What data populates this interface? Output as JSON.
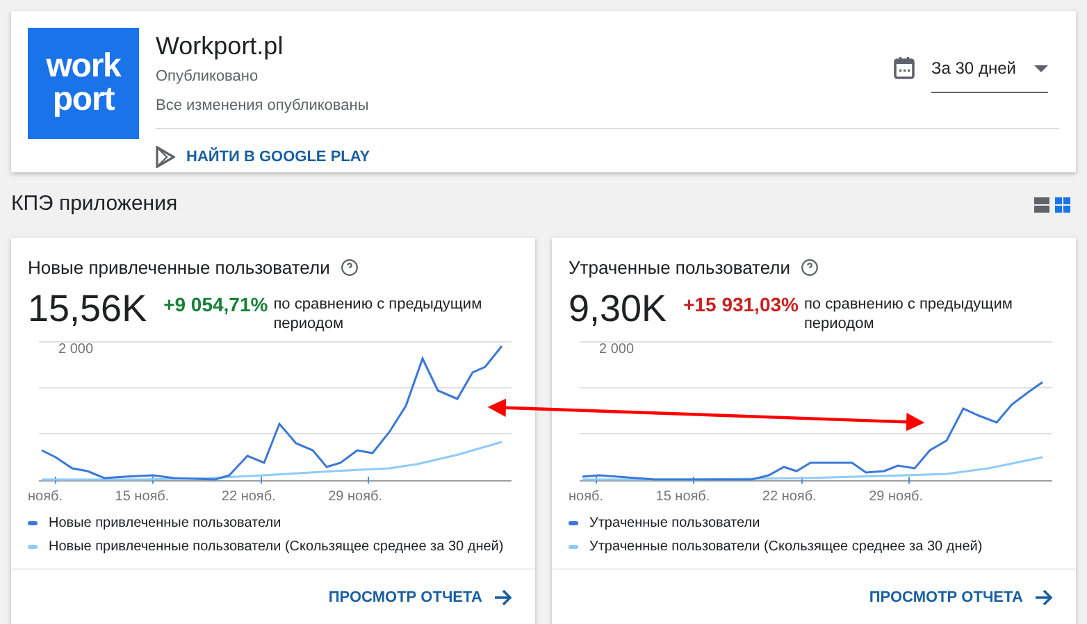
{
  "app": {
    "logo_lines": [
      "work",
      "port"
    ],
    "name": "Workport.pl",
    "status": "Опубликовано",
    "changes": "Все изменения опубликованы",
    "store_link": "НАЙТИ В GOOGLE PLAY"
  },
  "period": {
    "value": "За 30 дней"
  },
  "section_title": "КПЭ приложения",
  "view_toggle": [
    {
      "kind": "list",
      "selected": false
    },
    {
      "kind": "grid",
      "selected": true
    }
  ],
  "cards": [
    {
      "title": "Новые привлеченные пользователи",
      "value": "15,56K",
      "change": "+9 054,71%",
      "color": "#188038",
      "comparison": "по сравнению с предыдущим периодом",
      "y_label": "2 000",
      "x_labels": [
        "нояб.",
        "15 нояб.",
        "22 нояб.",
        "29 нояб."
      ],
      "legend": [
        "Новые привлеченные пользователи",
        "Новые привлеченные пользователи (Скользящее среднее за 30 дней)"
      ],
      "action": "ПРОСМОТР ОТЧЕТА"
    },
    {
      "title": "Утраченные пользователи",
      "value": "9,30K",
      "change": "+15 931,03%",
      "color": "#c5221f",
      "comparison": "по сравнению с предыдущим периодом",
      "y_label": "2 000",
      "x_labels": [
        "нояб.",
        "15 нояб.",
        "22 нояб.",
        "29 нояб."
      ],
      "legend": [
        "Утраченные пользователи",
        "Утраченные пользователи (Скользящее среднее за 30 дней)"
      ],
      "action": "ПРОСМОТР ОТЧЕТА"
    }
  ]
}
